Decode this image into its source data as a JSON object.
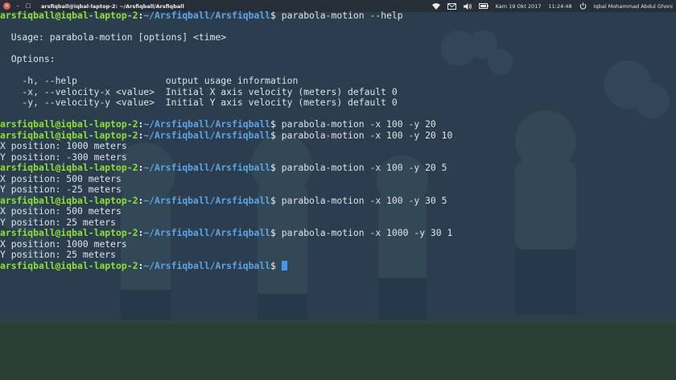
{
  "window": {
    "title": "arsfiqball@iqbal-laptop-2: ~/Arsfiqball/Arsfiqball",
    "close_glyph": "×",
    "minimize_glyph": "–",
    "maximize_glyph": "□"
  },
  "tray": {
    "wifi_icon": "wifi-icon",
    "mail_icon": "mail-icon",
    "volume_icon": "volume-icon",
    "battery_icon": "battery-icon",
    "date": "Kam 19 Okt 2017",
    "time": "11:24:48",
    "power_icon": "power-icon",
    "user": "Iqbal Mohammad Abdul Ghoni"
  },
  "prompt": {
    "user_host": "arsfiqball@iqbal-laptop-2",
    "sep": ":",
    "path": "~/Arsfiqball/Arsfiqball",
    "dollar": "$"
  },
  "terminal": {
    "lines": [
      {
        "kind": "prompt",
        "cmd": " parabola-motion --help"
      },
      {
        "kind": "out",
        "text": ""
      },
      {
        "kind": "out",
        "text": "  Usage: parabola-motion [options] <time>"
      },
      {
        "kind": "out",
        "text": ""
      },
      {
        "kind": "out",
        "text": "  Options:"
      },
      {
        "kind": "out",
        "text": ""
      },
      {
        "kind": "out",
        "text": "    -h, --help                output usage information"
      },
      {
        "kind": "out",
        "text": "    -x, --velocity-x <value>  Initial X axis velocity (meters) default 0"
      },
      {
        "kind": "out",
        "text": "    -y, --velocity-y <value>  Initial Y axis velocity (meters) default 0"
      },
      {
        "kind": "out",
        "text": ""
      },
      {
        "kind": "prompt",
        "cmd": " parabola-motion -x 100 -y 20"
      },
      {
        "kind": "prompt",
        "cmd": " parabola-motion -x 100 -y 20 10"
      },
      {
        "kind": "out",
        "text": "X position: 1000 meters"
      },
      {
        "kind": "out",
        "text": "Y position: -300 meters"
      },
      {
        "kind": "prompt",
        "cmd": " parabola-motion -x 100 -y 20 5"
      },
      {
        "kind": "out",
        "text": "X position: 500 meters"
      },
      {
        "kind": "out",
        "text": "Y position: -25 meters"
      },
      {
        "kind": "prompt",
        "cmd": " parabola-motion -x 100 -y 30 5"
      },
      {
        "kind": "out",
        "text": "X position: 500 meters"
      },
      {
        "kind": "out",
        "text": "Y position: 25 meters"
      },
      {
        "kind": "prompt",
        "cmd": " parabola-motion -x 1000 -y 30 1"
      },
      {
        "kind": "out",
        "text": "X position: 1000 meters"
      },
      {
        "kind": "out",
        "text": "Y position: 25 meters"
      },
      {
        "kind": "prompt",
        "cmd": " ",
        "cursor": true
      }
    ]
  },
  "colors": {
    "background": "#2b3d4e",
    "prompt_user": "#8ae234",
    "prompt_path": "#5ba5e6",
    "cursor": "#3f9af2"
  }
}
